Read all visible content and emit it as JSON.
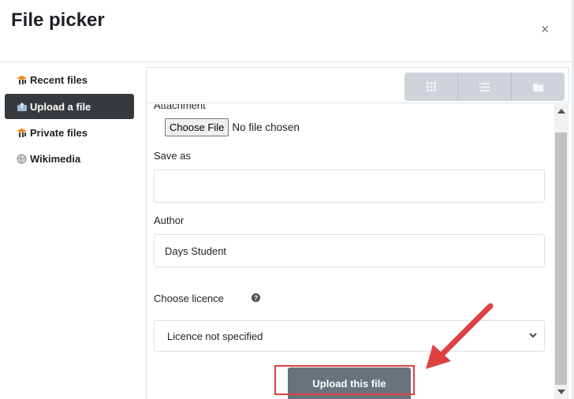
{
  "dialog": {
    "title": "File picker",
    "close_symbol": "×"
  },
  "sidebar": {
    "items": [
      {
        "label": "Recent files",
        "icon": "repository-icon",
        "active": false
      },
      {
        "label": "Upload a file",
        "icon": "upload-icon",
        "active": true
      },
      {
        "label": "Private files",
        "icon": "repository-icon",
        "active": false
      },
      {
        "label": "Wikimedia",
        "icon": "globe-icon",
        "active": false
      }
    ]
  },
  "toolbar": {
    "views": [
      "grid-view-icon",
      "list-view-icon",
      "folder-view-icon"
    ]
  },
  "form": {
    "attachment_label": "Attachment",
    "choose_file_label": "Choose File",
    "no_file_text": "No file chosen",
    "save_as_label": "Save as",
    "save_as_value": "",
    "author_label": "Author",
    "author_value": "Days Student",
    "licence_label": "Choose licence",
    "help_symbol": "?",
    "licence_value": "Licence not specified",
    "upload_label": "Upload this file"
  },
  "annotation": {
    "color": "#e04040"
  },
  "colors": {
    "active_bg": "#373a3c",
    "button_bg": "#6a737b",
    "toolbar_bg": "#ced4da"
  }
}
